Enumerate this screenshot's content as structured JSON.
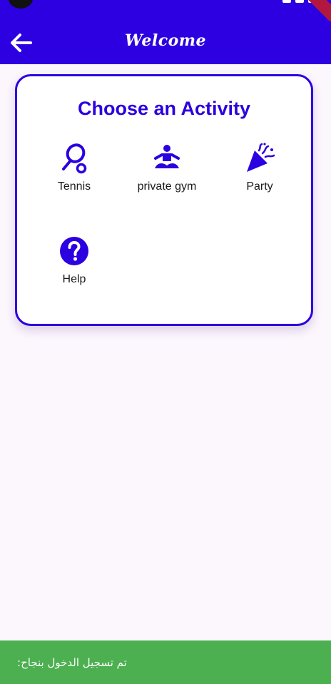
{
  "app_bar": {
    "title": "Welcome",
    "background_color": "#2c00e0",
    "back_icon": "arrow-left-icon"
  },
  "card": {
    "title": "Choose an Activity",
    "accent_color": "#2c00e0",
    "activities": [
      {
        "label": "Tennis",
        "icon": "tennis-racket-icon"
      },
      {
        "label": "private gym",
        "icon": "meditation-icon"
      },
      {
        "label": "Party",
        "icon": "party-popper-icon"
      },
      {
        "label": "Help",
        "icon": "help-circle-icon"
      }
    ]
  },
  "snackbar": {
    "message": ":تم تسجيل الدخول بنجاح",
    "background_color": "#4caf50"
  }
}
